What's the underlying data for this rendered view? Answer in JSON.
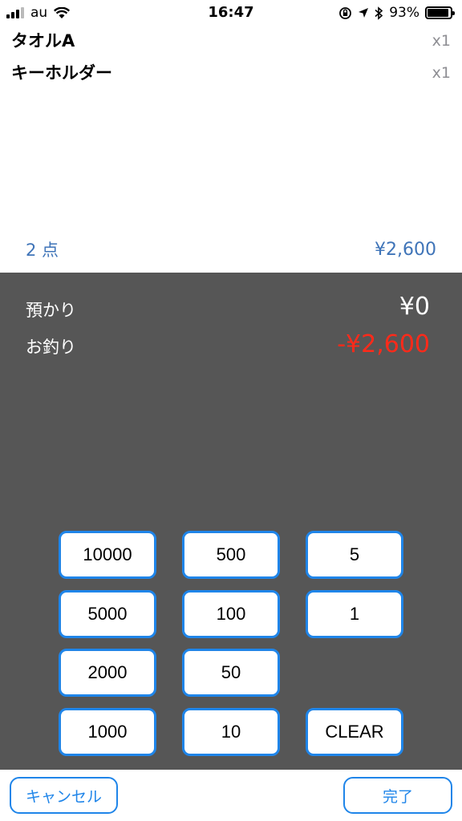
{
  "status": {
    "carrier": "au",
    "time": "16:47",
    "battery": "93%",
    "battery_level": 0.93
  },
  "items": [
    {
      "name": "タオルA",
      "qty": "x1"
    },
    {
      "name": "キーホルダー",
      "qty": "x1"
    }
  ],
  "summary": {
    "count": "2 点",
    "total": "¥2,600"
  },
  "payment": {
    "deposit_label": "預かり",
    "deposit_value": "¥0",
    "change_label": "お釣り",
    "change_value": "-¥2,600",
    "deposit_color": "#ffffff",
    "change_color": "#ff2a1a"
  },
  "keypad": {
    "k10000": "10000",
    "k500": "500",
    "k5": "5",
    "k5000": "5000",
    "k100": "100",
    "k1": "1",
    "k2000": "2000",
    "k50": "50",
    "k1000": "1000",
    "k10": "10",
    "clear": "CLEAR"
  },
  "bottom": {
    "cancel": "キャンセル",
    "done": "完了"
  },
  "colors": {
    "accent": "#1f85e9",
    "summary_text": "#3f74b8",
    "panel_bg": "#565656"
  }
}
